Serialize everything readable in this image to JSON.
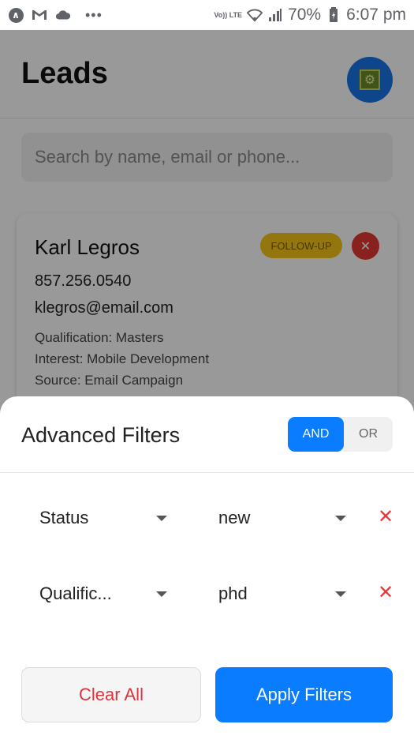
{
  "status_bar": {
    "time": "6:07 pm",
    "battery": "70%",
    "network_label": "Vo)) LTE",
    "left_icons": [
      "app-circle-icon",
      "gmail-icon",
      "cloud-icon",
      "more-dots-icon"
    ],
    "right_icons": [
      "volte-icon",
      "wifi-icon",
      "signal-icon",
      "battery-icon"
    ]
  },
  "page": {
    "title": "Leads",
    "search_placeholder": "Search by name, email or phone..."
  },
  "lead_card": {
    "name": "Karl Legros",
    "status_badge": "FOLLOW-UP",
    "phone": "857.256.0540",
    "email": "klegros@email.com",
    "qualification": "Qualification: Masters",
    "interest": "Interest: Mobile Development",
    "source": "Source: Email Campaign",
    "badge_color": "#f5c518"
  },
  "filters_sheet": {
    "title": "Advanced Filters",
    "logic_options": [
      {
        "label": "AND",
        "active": true
      },
      {
        "label": "OR",
        "active": false
      }
    ],
    "rows": [
      {
        "field": "Status",
        "value": "new"
      },
      {
        "field": "Qualific...",
        "value": "phd"
      }
    ],
    "clear_label": "Clear All",
    "apply_label": "Apply Filters"
  },
  "colors": {
    "primary": "#0a7cff",
    "danger": "#e53935"
  }
}
